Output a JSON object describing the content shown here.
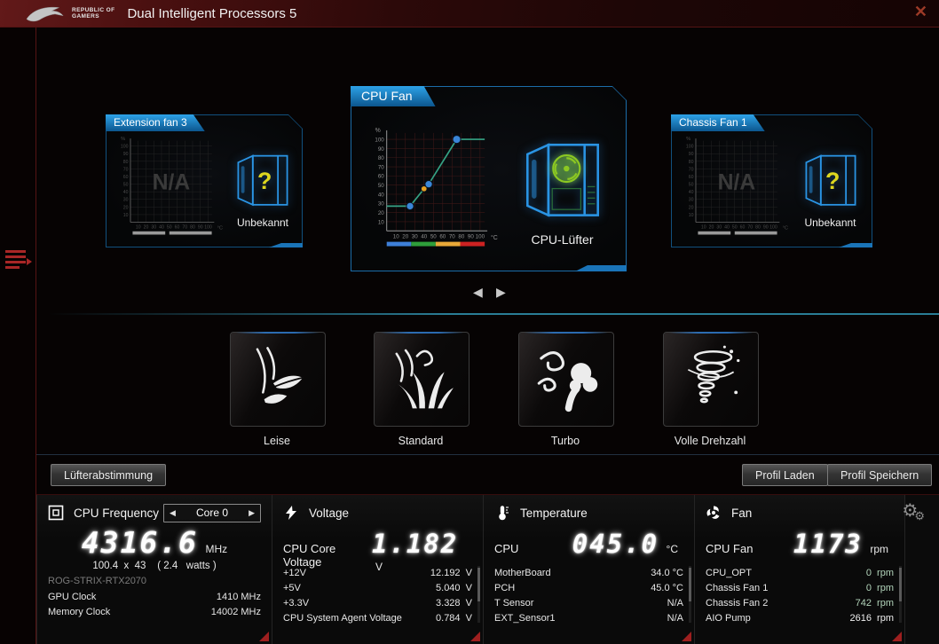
{
  "colors": {
    "accent_blue": "#1b84c8",
    "fan_ok_green": "#b2d4ba",
    "alert_red": "#9e1f1f",
    "curve_line": "#35a385",
    "point_blue": "#3a86d8",
    "point_orange": "#e8a020"
  },
  "icons": {
    "prev": "◀",
    "next": "▶",
    "close": "✕",
    "gear_big": "⚙",
    "gear_small": "⚙"
  },
  "titlebar": {
    "brand_top": "REPUBLIC OF",
    "brand_bottom": "GAMERS",
    "title": "Dual Intelligent Processors 5"
  },
  "carousel": {
    "left_card": {
      "title": "Extension fan 3",
      "na": "N/A",
      "device": "Unbekannt",
      "mark": "?"
    },
    "center_card": {
      "title": "CPU Fan",
      "device": "CPU-Lüfter"
    },
    "right_card": {
      "title": "Chassis Fan 1",
      "na": "N/A",
      "device": "Unbekannt",
      "mark": "?"
    }
  },
  "chart_data": {
    "type": "line",
    "title": "CPU Fan speed curve",
    "xlabel": "°C",
    "ylabel": "%",
    "x_ticks": [
      10,
      20,
      30,
      40,
      50,
      60,
      70,
      80,
      90,
      100
    ],
    "y_ticks": [
      10,
      20,
      30,
      40,
      50,
      60,
      70,
      80,
      90,
      100
    ],
    "xlim": [
      0,
      105
    ],
    "ylim": [
      0,
      107
    ],
    "grid": true,
    "curve": [
      [
        0,
        27
      ],
      [
        25,
        27
      ],
      [
        40,
        46
      ],
      [
        45,
        51
      ],
      [
        75,
        100
      ],
      [
        105,
        100
      ]
    ],
    "points": [
      {
        "x": 25,
        "y": 27,
        "color": "#3a86d8",
        "r": 4.2
      },
      {
        "x": 40,
        "y": 46,
        "color": "#e8a020",
        "r": 3.4
      },
      {
        "x": 45,
        "y": 51,
        "color": "#3a86d8",
        "r": 4.2
      },
      {
        "x": 75,
        "y": 100,
        "color": "#3a86d8",
        "r": 4.6
      }
    ],
    "temp_band_colors": [
      "#3d7fd8",
      "#2e9e3a",
      "#e8a838",
      "#cc2222"
    ],
    "line_color": "#35a385"
  },
  "modes": [
    {
      "label": "Leise",
      "icon": "leaf-wind-icon"
    },
    {
      "label": "Standard",
      "icon": "grass-wind-icon"
    },
    {
      "label": "Turbo",
      "icon": "strong-wind-icon"
    },
    {
      "label": "Volle Drehzahl",
      "icon": "tornado-icon"
    }
  ],
  "actions": {
    "fan_tuning": "Lüfterabstimmung",
    "profile_load": "Profil Laden",
    "profile_save": "Profil Speichern"
  },
  "monitor": {
    "cpu_frequency": {
      "title": "CPU Frequency",
      "selector": "Core 0",
      "value": "4316.6",
      "unit": "MHz",
      "detail": "100.4  x  43    ( 2.4   watts )",
      "device": "ROG-STRIX-RTX2070",
      "rows": [
        {
          "label": "GPU Clock",
          "value": "1410 MHz"
        },
        {
          "label": "Memory Clock",
          "value": "14002 MHz"
        }
      ]
    },
    "voltage": {
      "title": "Voltage",
      "main_label": "CPU Core Voltage",
      "value": "1.182",
      "unit": "V",
      "rows": [
        {
          "label": "+12V",
          "value": "12.192  V"
        },
        {
          "label": "+5V",
          "value": "5.040  V"
        },
        {
          "label": "+3.3V",
          "value": "3.328  V"
        },
        {
          "label": "CPU System Agent Voltage",
          "value": "0.784  V"
        }
      ]
    },
    "temperature": {
      "title": "Temperature",
      "main_label": "CPU",
      "value": "045.0",
      "unit": "°C",
      "rows": [
        {
          "label": "MotherBoard",
          "value": "34.0 °C"
        },
        {
          "label": "PCH",
          "value": "45.0 °C"
        },
        {
          "label": "T Sensor",
          "value": "N/A"
        },
        {
          "label": "EXT_Sensor1",
          "value": "N/A"
        }
      ]
    },
    "fan": {
      "title": "Fan",
      "main_label": "CPU Fan",
      "value": "1173",
      "unit": "rpm",
      "rows": [
        {
          "label": "CPU_OPT",
          "value": "0  rpm",
          "value_color": "#b2d4ba"
        },
        {
          "label": "Chassis Fan 1",
          "value": "0  rpm",
          "value_color": "#b2d4ba"
        },
        {
          "label": "Chassis Fan 2",
          "value": "742  rpm",
          "value_color": "#b2d4ba"
        },
        {
          "label": "AIO Pump",
          "value": "2616  rpm",
          "value_color": "#f0f0f0"
        }
      ]
    }
  }
}
